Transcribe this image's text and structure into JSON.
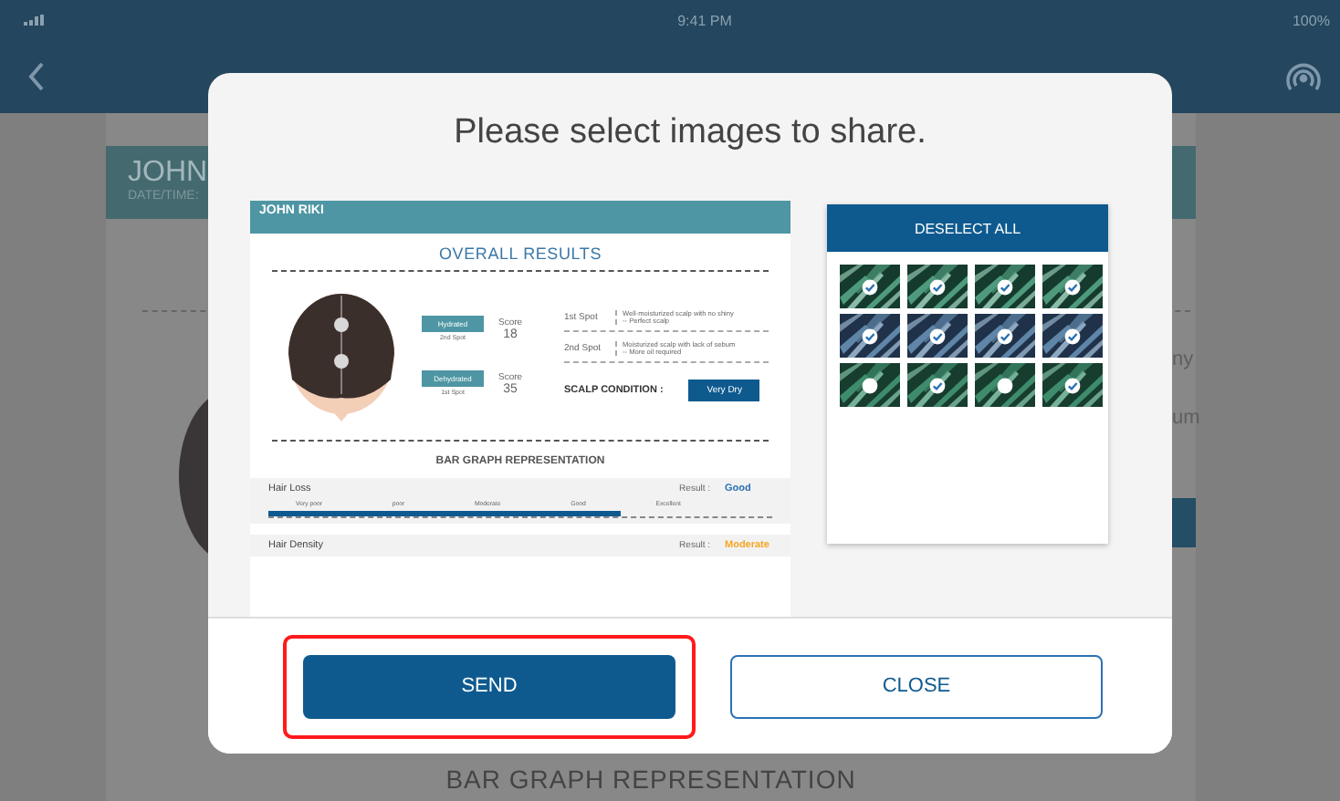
{
  "status_bar": {
    "time": "9:41 PM",
    "battery": "100%"
  },
  "background": {
    "name": "JOHN",
    "date_label": "DATE/TIME:",
    "fragments": [
      "ny",
      "um"
    ],
    "section_title": "BAR GRAPH REPRESENTATION"
  },
  "dialog": {
    "title": "Please select images to share.",
    "report": {
      "name": "JOHN RIKI",
      "heading": "OVERALL RESULTS",
      "spots": [
        {
          "badge": "Hydrated",
          "caption": "2nd Spot",
          "score_label": "Score",
          "score": "18"
        },
        {
          "badge": "Dehydrated",
          "caption": "1st Spot",
          "score_label": "Score",
          "score": "35"
        }
      ],
      "notes": [
        {
          "label": "1st Spot",
          "lines": [
            "Well-moisturized scalp with no shiny",
            "-- Perfect scalp"
          ]
        },
        {
          "label": "2nd Spot",
          "lines": [
            "Moisturized scalp with lack of sebum",
            "-- More oil required"
          ]
        }
      ],
      "condition_label": "SCALP CONDITION :",
      "condition": "Very Dry",
      "graph_title": "BAR GRAPH REPRESENTATION",
      "metrics": [
        {
          "name": "Hair Loss",
          "result_label": "Result :",
          "result": "Good",
          "color": "#2a72b5",
          "scale": [
            "Very poor",
            "poor",
            "Moderate",
            "Good",
            "Excellent"
          ],
          "level": 0.7
        },
        {
          "name": "Hair Density",
          "result_label": "Result :",
          "result": "Moderate",
          "color": "#f5a623"
        }
      ]
    },
    "deselect_button": "DESELECT ALL",
    "images": [
      {
        "selected": true
      },
      {
        "selected": true
      },
      {
        "selected": true
      },
      {
        "selected": true
      },
      {
        "selected": true
      },
      {
        "selected": true
      },
      {
        "selected": true
      },
      {
        "selected": true
      },
      {
        "selected": false
      },
      {
        "selected": true
      },
      {
        "selected": false
      },
      {
        "selected": true
      }
    ],
    "buttons": [
      {
        "label": "SEND",
        "kind": "primary",
        "highlighted": true
      },
      {
        "label": "CLOSE",
        "kind": "secondary",
        "highlighted": false
      }
    ]
  }
}
